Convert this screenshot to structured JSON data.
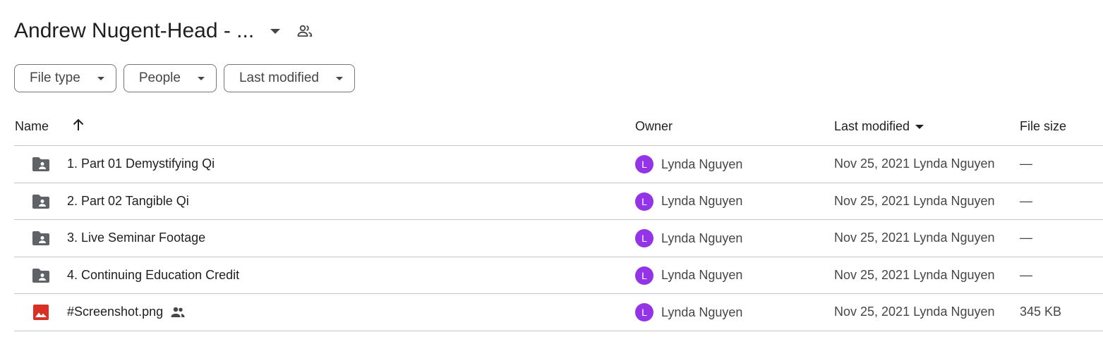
{
  "folder": {
    "title": "Andrew Nugent-Head - ...",
    "caret_icon": "chevron-down-icon",
    "shared_icon": "people-outline-icon"
  },
  "filters": [
    {
      "label": "File type"
    },
    {
      "label": "People"
    },
    {
      "label": "Last modified"
    }
  ],
  "columns": {
    "name": "Name",
    "owner": "Owner",
    "last_modified": "Last modified",
    "file_size": "File size",
    "sort_icon": "arrow-up-icon"
  },
  "rows": [
    {
      "type": "shared-folder",
      "icon": "shared-folder-icon",
      "name": "1. Part 01 Demystifying Qi",
      "owner_initial": "L",
      "owner": "Lynda Nguyen",
      "modified": "Nov 25, 2021 Lynda Nguyen",
      "size": "—"
    },
    {
      "type": "shared-folder",
      "icon": "shared-folder-icon",
      "name": "2. Part 02 Tangible Qi",
      "owner_initial": "L",
      "owner": "Lynda Nguyen",
      "modified": "Nov 25, 2021 Lynda Nguyen",
      "size": "—"
    },
    {
      "type": "shared-folder",
      "icon": "shared-folder-icon",
      "name": "3. Live Seminar Footage",
      "owner_initial": "L",
      "owner": "Lynda Nguyen",
      "modified": "Nov 25, 2021 Lynda Nguyen",
      "size": "—"
    },
    {
      "type": "shared-folder",
      "icon": "shared-folder-icon",
      "name": "4. Continuing Education Credit",
      "owner_initial": "L",
      "owner": "Lynda Nguyen",
      "modified": "Nov 25, 2021 Lynda Nguyen",
      "size": "—"
    },
    {
      "type": "image",
      "icon": "image-file-icon",
      "name": "#Screenshot.png",
      "shared": true,
      "owner_initial": "L",
      "owner": "Lynda Nguyen",
      "modified": "Nov 25, 2021 Lynda Nguyen",
      "size": "345 KB"
    }
  ],
  "colors": {
    "avatar": "#9334e6",
    "folder_icon": "#5f6368",
    "image_icon": "#d93025",
    "divider": "#c4c7c5"
  }
}
